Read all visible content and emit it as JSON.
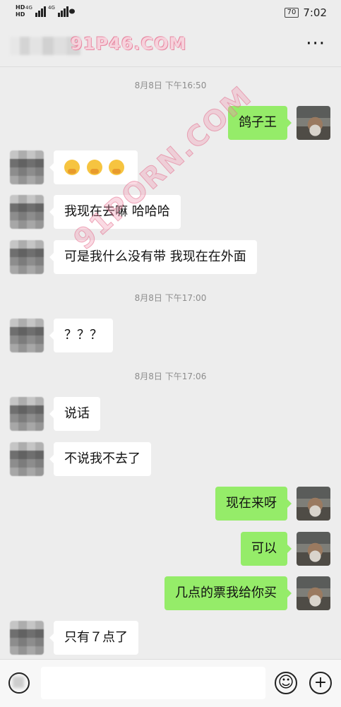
{
  "status_bar": {
    "network_a": "HD",
    "network_b": "HD",
    "signal": "4G",
    "battery": "70",
    "time": "7:02"
  },
  "header": {
    "watermark_text": "91P46.COM",
    "more_icon": "more-dots"
  },
  "overlay_watermark": "91PORN.COM",
  "messages": [
    {
      "type": "time",
      "text": "8月8日 下午16:50"
    },
    {
      "type": "self",
      "text": "鸽子王"
    },
    {
      "type": "other",
      "emoji_count": 3
    },
    {
      "type": "other",
      "text": "我现在去嘛 哈哈哈"
    },
    {
      "type": "other",
      "text": "可是我什么没有带 我现在在外面"
    },
    {
      "type": "time",
      "text": "8月8日 下午17:00"
    },
    {
      "type": "other",
      "text": "？？？"
    },
    {
      "type": "time",
      "text": "8月8日 下午17:06"
    },
    {
      "type": "other",
      "text": "说话"
    },
    {
      "type": "other",
      "text": "不说我不去了"
    },
    {
      "type": "self",
      "text": "现在来呀"
    },
    {
      "type": "self",
      "text": "可以"
    },
    {
      "type": "self",
      "text": "几点的票我给你买"
    },
    {
      "type": "other",
      "text": "只有７点了"
    }
  ],
  "input": {
    "value": "",
    "placeholder": ""
  },
  "icons": {
    "voice": "voice-icon",
    "emoji": "emoji-icon",
    "plus": "plus-icon"
  },
  "colors": {
    "background": "#ededed",
    "self_bubble": "#95ec69",
    "other_bubble": "#ffffff",
    "watermark": "#f6d2dc"
  }
}
